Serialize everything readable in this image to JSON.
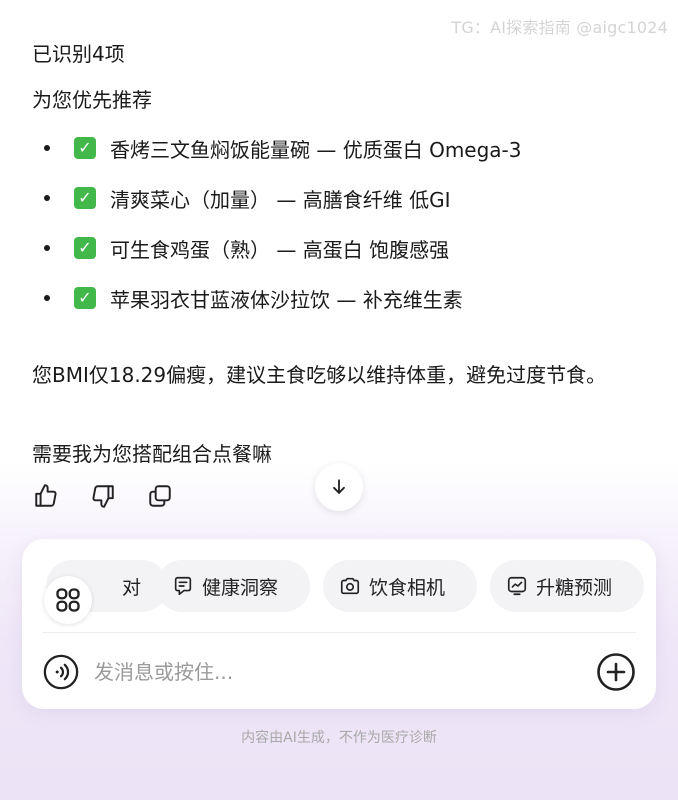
{
  "watermark": "TG：AI探索指南 @aigc1024",
  "message": {
    "identified": "已识别4项",
    "recommend_heading": "为您优先推荐",
    "items": [
      {
        "text": "香烤三文鱼焖饭能量碗 — 优质蛋白 Omega-3"
      },
      {
        "text": "清爽菜心（加量） — 高膳食纤维 低GI"
      },
      {
        "text": "可生食鸡蛋（熟） — 高蛋白 饱腹感强"
      },
      {
        "text": "苹果羽衣甘蓝液体沙拉饮 — 补充维生素"
      }
    ],
    "bmi_advice": " 您BMI仅18.29偏瘦，建议主食吃够以维持体重，避免过度节食。",
    "follow_up": "需要我为您搭配组合点餐嘛"
  },
  "actions": {
    "like": "thumbs-up-icon",
    "dislike": "thumbs-down-icon",
    "copy": "copy-icon"
  },
  "composer": {
    "chips": [
      {
        "label": "对",
        "icon": "partial-chip"
      },
      {
        "label": "健康洞察",
        "icon": "health-insight-icon"
      },
      {
        "label": "饮食相机",
        "icon": "camera-icon"
      },
      {
        "label": "升糖预测",
        "icon": "glucose-chart-icon"
      }
    ],
    "input_placeholder": "发消息或按住...",
    "input_value": ""
  },
  "disclaimer": "内容由AI生成，不作为医疗诊断",
  "colors": {
    "check_green": "#43b84a",
    "text": "#1a1a1a",
    "placeholder": "#9a9a9a",
    "gradient_bottom": "#ece4f6"
  }
}
